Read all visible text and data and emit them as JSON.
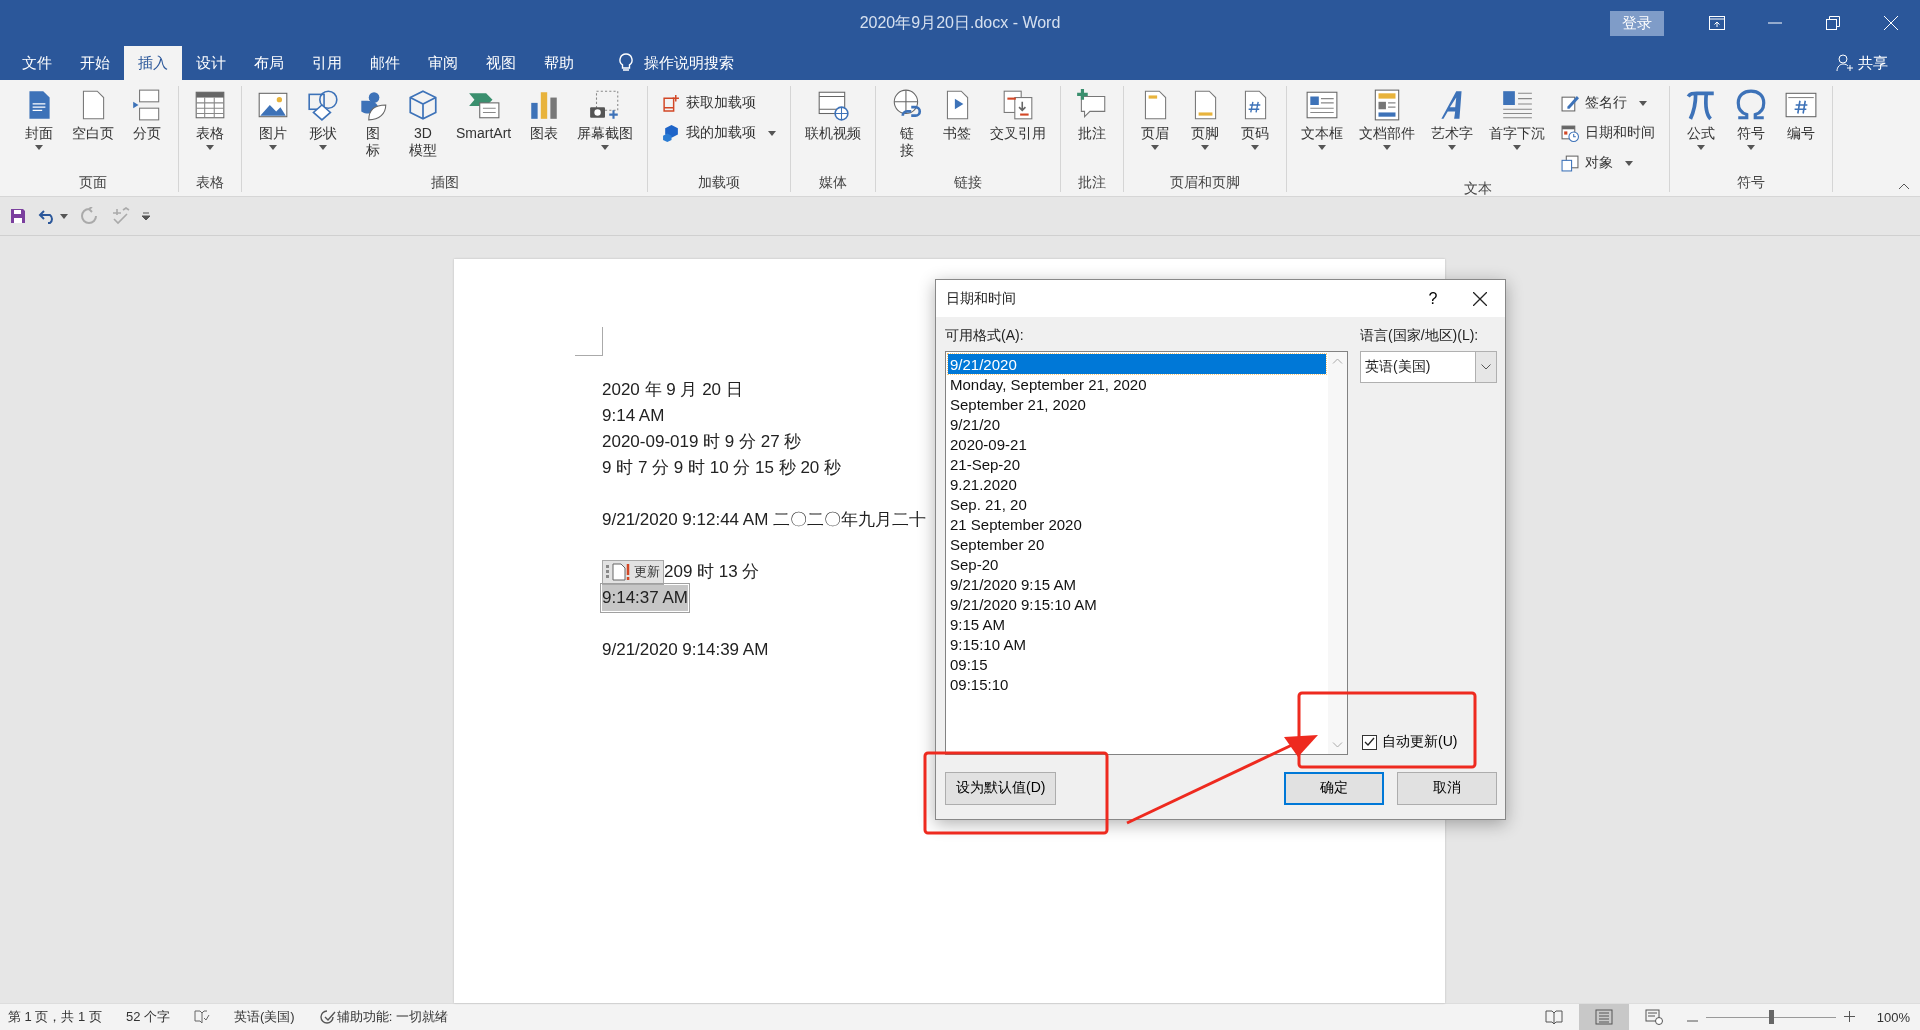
{
  "title_bar": {
    "title": "2020年9月20日.docx - Word",
    "sign_in": "登录"
  },
  "menu_tabs": [
    {
      "label": "文件",
      "selected": false
    },
    {
      "label": "开始",
      "selected": false
    },
    {
      "label": "插入",
      "selected": true
    },
    {
      "label": "设计",
      "selected": false
    },
    {
      "label": "布局",
      "selected": false
    },
    {
      "label": "引用",
      "selected": false
    },
    {
      "label": "邮件",
      "selected": false
    },
    {
      "label": "审阅",
      "selected": false
    },
    {
      "label": "视图",
      "selected": false
    },
    {
      "label": "帮助",
      "selected": false
    }
  ],
  "tell_me": "操作说明搜索",
  "share": "共享",
  "ribbon": [
    {
      "label": "页面",
      "buttons": [
        {
          "kind": "large",
          "label": "封面",
          "dropdown": true
        },
        {
          "kind": "large",
          "label": "空白页",
          "dropdown": false
        },
        {
          "kind": "large",
          "label": "分页",
          "dropdown": false
        }
      ]
    },
    {
      "label": "表格",
      "buttons": [
        {
          "kind": "large",
          "label": "表格",
          "dropdown": true
        }
      ]
    },
    {
      "label": "插图",
      "buttons": [
        {
          "kind": "large",
          "label": "图片",
          "dropdown": true
        },
        {
          "kind": "large",
          "label": "形状",
          "dropdown": true
        },
        {
          "kind": "large",
          "label": "图标",
          "dropdown": false,
          "wrap": true
        },
        {
          "kind": "large",
          "label": "3D 模型",
          "dropdown": false
        },
        {
          "kind": "large",
          "label": "SmartArt",
          "dropdown": false
        },
        {
          "kind": "large",
          "label": "图表",
          "dropdown": false
        },
        {
          "kind": "large",
          "label": "屏幕截图",
          "dropdown": true
        }
      ]
    },
    {
      "label": "加载项",
      "buttons": [
        {
          "kind": "small",
          "label": "获取加载项",
          "dropdown": false
        },
        {
          "kind": "small",
          "label": "我的加载项",
          "dropdown": true
        }
      ]
    },
    {
      "label": "媒体",
      "buttons": [
        {
          "kind": "large",
          "label": "联机视频",
          "dropdown": false
        }
      ]
    },
    {
      "label": "链接",
      "buttons": [
        {
          "kind": "large",
          "label": "链接",
          "dropdown": false,
          "wrap": true
        },
        {
          "kind": "large",
          "label": "书签",
          "dropdown": false
        },
        {
          "kind": "large",
          "label": "交叉引用",
          "dropdown": false
        }
      ]
    },
    {
      "label": "批注",
      "buttons": [
        {
          "kind": "large",
          "label": "批注",
          "dropdown": false
        }
      ]
    },
    {
      "label": "页眉和页脚",
      "buttons": [
        {
          "kind": "large",
          "label": "页眉",
          "dropdown": true
        },
        {
          "kind": "large",
          "label": "页脚",
          "dropdown": true
        },
        {
          "kind": "large",
          "label": "页码",
          "dropdown": true
        }
      ]
    },
    {
      "label": "文本",
      "buttons": [
        {
          "kind": "large",
          "label": "文本框",
          "dropdown": true
        },
        {
          "kind": "large",
          "label": "文档部件",
          "dropdown": true
        },
        {
          "kind": "large",
          "label": "艺术字",
          "dropdown": true
        },
        {
          "kind": "large",
          "label": "首字下沉",
          "dropdown": true
        },
        {
          "kind": "small",
          "label": "签名行",
          "dropdown": true
        },
        {
          "kind": "small",
          "label": "日期和时间",
          "dropdown": false
        },
        {
          "kind": "small",
          "label": "对象",
          "dropdown": true
        }
      ]
    },
    {
      "label": "符号",
      "buttons": [
        {
          "kind": "large",
          "label": "公式",
          "dropdown": true
        },
        {
          "kind": "large",
          "label": "符号",
          "dropdown": true
        },
        {
          "kind": "large",
          "label": "编号",
          "dropdown": false
        }
      ]
    }
  ],
  "document": {
    "lines": [
      {
        "kind": "text",
        "text": "2020 年 9 月 20 日",
        "selected": false
      },
      {
        "kind": "text",
        "text": "9:14 AM",
        "selected": false
      },
      {
        "kind": "text",
        "text": "2020-09-019 时 9 分 27 秒",
        "selected": false
      },
      {
        "kind": "text",
        "text": "9 时 7 分 9 时 10 分 15 秒 20 秒",
        "selected": false
      },
      {
        "kind": "blank"
      },
      {
        "kind": "text",
        "text": "9/21/2020 9:12:44 AM 二〇二〇年九月二十",
        "selected": false
      },
      {
        "kind": "blank"
      },
      {
        "kind": "field",
        "update_label": "更新",
        "text": "209 时 13 分",
        "selected": false
      },
      {
        "kind": "text",
        "text": "9:14:37 AM",
        "selected": true
      },
      {
        "kind": "blank"
      },
      {
        "kind": "text",
        "text": "9/21/2020 9:14:39 AM",
        "selected": false
      }
    ]
  },
  "dialog": {
    "title": "日期和时间",
    "help": "?",
    "formats_label": "可用格式(A):",
    "formats": [
      {
        "text": "9/21/2020",
        "selected": true
      },
      {
        "text": "Monday, September 21, 2020",
        "selected": false
      },
      {
        "text": "September 21, 2020",
        "selected": false
      },
      {
        "text": "9/21/20",
        "selected": false
      },
      {
        "text": "2020-09-21",
        "selected": false
      },
      {
        "text": "21-Sep-20",
        "selected": false
      },
      {
        "text": "9.21.2020",
        "selected": false
      },
      {
        "text": "Sep. 21, 20",
        "selected": false
      },
      {
        "text": "21 September 2020",
        "selected": false
      },
      {
        "text": "September 20",
        "selected": false
      },
      {
        "text": "Sep-20",
        "selected": false
      },
      {
        "text": "9/21/2020 9:15 AM",
        "selected": false
      },
      {
        "text": "9/21/2020 9:15:10 AM",
        "selected": false
      },
      {
        "text": "9:15 AM",
        "selected": false
      },
      {
        "text": "9:15:10 AM",
        "selected": false
      },
      {
        "text": "09:15",
        "selected": false
      },
      {
        "text": "09:15:10",
        "selected": false
      }
    ],
    "language_label": "语言(国家/地区)(L):",
    "language": "英语(美国)",
    "auto_update": {
      "label": "自动更新(U)",
      "checked": true
    },
    "set_default": "设为默认值(D)",
    "ok": "确定",
    "cancel": "取消"
  },
  "status_bar": {
    "page": "第 1 页，共 1 页",
    "words": "52 个字",
    "language": "英语(美国)",
    "accessibility": "辅助功能: 一切就绪",
    "views": [
      {
        "selected": false
      },
      {
        "selected": true
      },
      {
        "selected": false
      }
    ],
    "zoom": {
      "level": 0.5,
      "reading": "100%"
    }
  }
}
